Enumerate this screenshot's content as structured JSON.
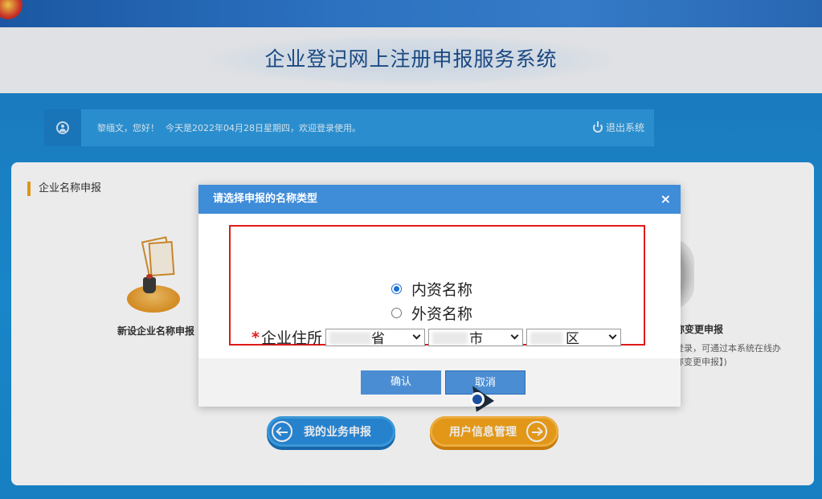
{
  "header": {
    "system_title": "企业登记网上注册申报服务系统"
  },
  "welcome": {
    "greeting": "黎缅文，您好！",
    "date_text": "今天是2022年04月28日星期四，欢迎登录使用。",
    "logout_label": "退出系统"
  },
  "panel": {
    "title": "企业名称申报",
    "left_card_label": "新设企业名称申报",
    "right_card_label": "称变更申报",
    "right_card_desc1": "登录，可通过本系统在线办",
    "right_card_desc2": "称变更申报】)"
  },
  "bottom_buttons": {
    "my_business": "我的业务申报",
    "user_info": "用户信息管理"
  },
  "modal": {
    "title": "请选择申报的名称类型",
    "close": "×",
    "options": [
      {
        "label": "内资名称",
        "checked": true
      },
      {
        "label": "外资名称",
        "checked": false
      }
    ],
    "address_label": "企业住所",
    "province_suffix": "省",
    "city_suffix": "市",
    "district_suffix": "区",
    "confirm_label": "确认",
    "cancel_label": "取消"
  },
  "colors": {
    "header_blue": "#3f8cd9",
    "highlight_red": "#e11a1a",
    "body_blue": "#1a8fd6",
    "accent_orange": "#f6a41b"
  }
}
